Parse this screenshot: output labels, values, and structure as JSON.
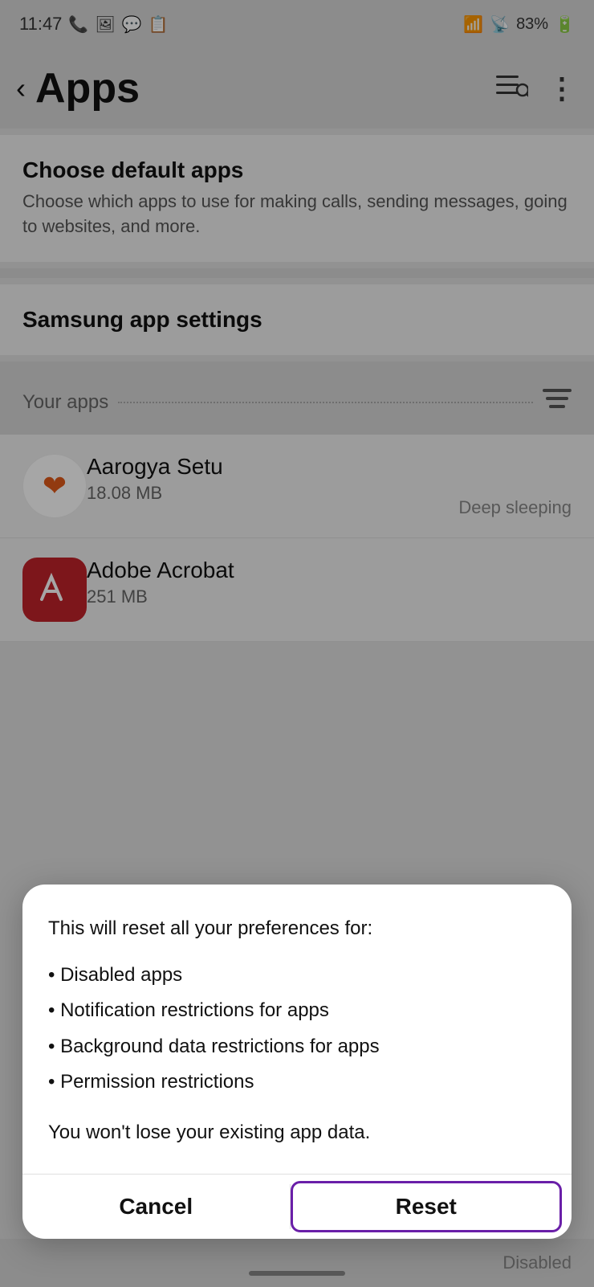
{
  "statusBar": {
    "time": "11:47",
    "battery": "83%",
    "icons": [
      "phone",
      "gallery",
      "whatsapp",
      "sim"
    ]
  },
  "header": {
    "backLabel": "‹",
    "title": "Apps",
    "searchListIcon": "≡🔍",
    "moreIcon": "⋮"
  },
  "sections": {
    "defaultApps": {
      "title": "Choose default apps",
      "subtitle": "Choose which apps to use for making calls, sending messages, going to websites, and more."
    },
    "samsungSettings": {
      "title": "Samsung app settings"
    },
    "yourApps": {
      "label": "Your apps",
      "sortIcon": "sort"
    }
  },
  "apps": [
    {
      "name": "Aarogya Setu",
      "size": "18.08 MB",
      "status": "Deep sleeping",
      "iconType": "aarogya"
    },
    {
      "name": "Adobe Acrobat",
      "size": "251 MB",
      "status": "",
      "iconType": "adobe"
    }
  ],
  "dialog": {
    "intro": "This will reset all your preferences for:",
    "items": [
      "Disabled apps",
      "Notification restrictions for apps",
      "Background data restrictions for apps",
      "Permission restrictions"
    ],
    "note": "You won't lose your existing app data.",
    "cancelLabel": "Cancel",
    "resetLabel": "Reset"
  },
  "bottomBar": {
    "disabledLabel": "Disabled"
  }
}
